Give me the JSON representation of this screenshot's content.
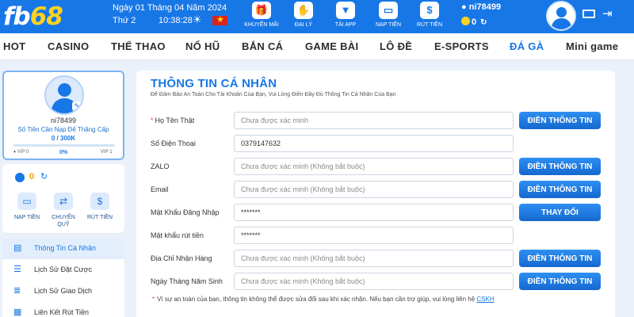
{
  "header": {
    "logo_prefix": "fb",
    "logo_suffix": "68",
    "date": "Ngày 01 Tháng 04 Năm 2024",
    "weekday": "Thứ 2",
    "time": "10:38:28",
    "weather_icon": "sun-icon",
    "flag_icon": "vietnam-flag-icon",
    "actions": [
      {
        "label": "KHUYẾN MÃI",
        "icon": "gift-icon"
      },
      {
        "label": "ĐẠI LÝ",
        "icon": "handshake-icon"
      },
      {
        "label": "TẢI APP",
        "icon": "phone-download-icon"
      },
      {
        "label": "NẠP TIỀN",
        "icon": "wallet-icon"
      },
      {
        "label": "RÚT TIỀN",
        "icon": "withdraw-icon"
      }
    ],
    "username": "ni78499",
    "balance": "0",
    "colors": {
      "primary": "#1877e6",
      "accent": "#ffd21f"
    }
  },
  "nav": {
    "items": [
      "HOT",
      "CASINO",
      "THỂ THAO",
      "NỔ HŨ",
      "BẮN CÁ",
      "GAME BÀI",
      "LÔ ĐỀ",
      "E-SPORTS",
      "ĐÁ GÀ",
      "Mini game"
    ],
    "active_index": 8
  },
  "profile": {
    "username": "ni78499",
    "desc": "Số Tiền Cần Nạp Để Thăng Cấp",
    "progress": "0  /  300K",
    "vip_left": "VIP 0",
    "vip_pct": "0%",
    "vip_right": "VIP 1",
    "progress_fraction": 0
  },
  "wallet": {
    "balance": "0",
    "actions": [
      {
        "label": "NẠP TIỀN",
        "icon": "wallet-icon"
      },
      {
        "label": "CHUYỂN QUỸ",
        "icon": "transfer-icon"
      },
      {
        "label": "RÚT TIỀN",
        "icon": "withdraw-icon"
      }
    ]
  },
  "sidebar": {
    "items": [
      {
        "label": "Thông Tin Cá Nhân",
        "icon": "id-card-icon",
        "active": true
      },
      {
        "label": "Lịch Sử Đặt Cược",
        "icon": "history-icon",
        "active": false
      },
      {
        "label": "Lịch Sử Giao Dịch",
        "icon": "transaction-icon",
        "active": false
      },
      {
        "label": "Liên Kết Rút Tiền",
        "icon": "link-icon",
        "active": false
      }
    ]
  },
  "main": {
    "title": "THÔNG TIN CÁ NHÂN",
    "subtitle": "Để Đảm Bảo An Toàn Cho Tài Khoản Của Bạn, Vui Lòng Điền Đầy Đủ Thông Tin Cá Nhân Của Bạn",
    "fields": [
      {
        "label": "Họ Tên Thật",
        "required": true,
        "value": "",
        "placeholder": "Chưa được xác minh",
        "button": "ĐIỀN THÔNG TIN"
      },
      {
        "label": "Số Điện Thoại",
        "required": false,
        "value": "0379147632",
        "placeholder": "",
        "button": ""
      },
      {
        "label": "ZALO",
        "required": false,
        "value": "",
        "placeholder": "Chưa được xác minh (Không bắt buộc)",
        "button": "ĐIỀN THÔNG TIN"
      },
      {
        "label": "Email",
        "required": false,
        "value": "",
        "placeholder": "Chưa được xác minh (Không bắt buộc)",
        "button": "ĐIỀN THÔNG TIN"
      },
      {
        "label": "Mật Khẩu Đăng Nhập",
        "required": false,
        "value": "*******",
        "placeholder": "",
        "button": "THAY ĐỔI"
      },
      {
        "label": "Mật khẩu rút tiền",
        "required": false,
        "value": "*******",
        "placeholder": "",
        "button": ""
      },
      {
        "label": "Địa Chỉ Nhận Hàng",
        "required": false,
        "value": "",
        "placeholder": "Chưa được xác minh (Không bắt buộc)",
        "button": "ĐIỀN THÔNG TIN"
      },
      {
        "label": "Ngày Tháng Năm Sinh",
        "required": false,
        "value": "",
        "placeholder": "Chưa được xác minh (Không bắt buộc)",
        "button": "ĐIỀN THÔNG TIN"
      }
    ],
    "footnote": "Vì sự an toàn của bạn, thông tin không thể được sửa đổi sau khi xác nhận. Nếu bạn cần trợ giúp, vui lòng liên hệ",
    "footnote_link": "CSKH"
  }
}
